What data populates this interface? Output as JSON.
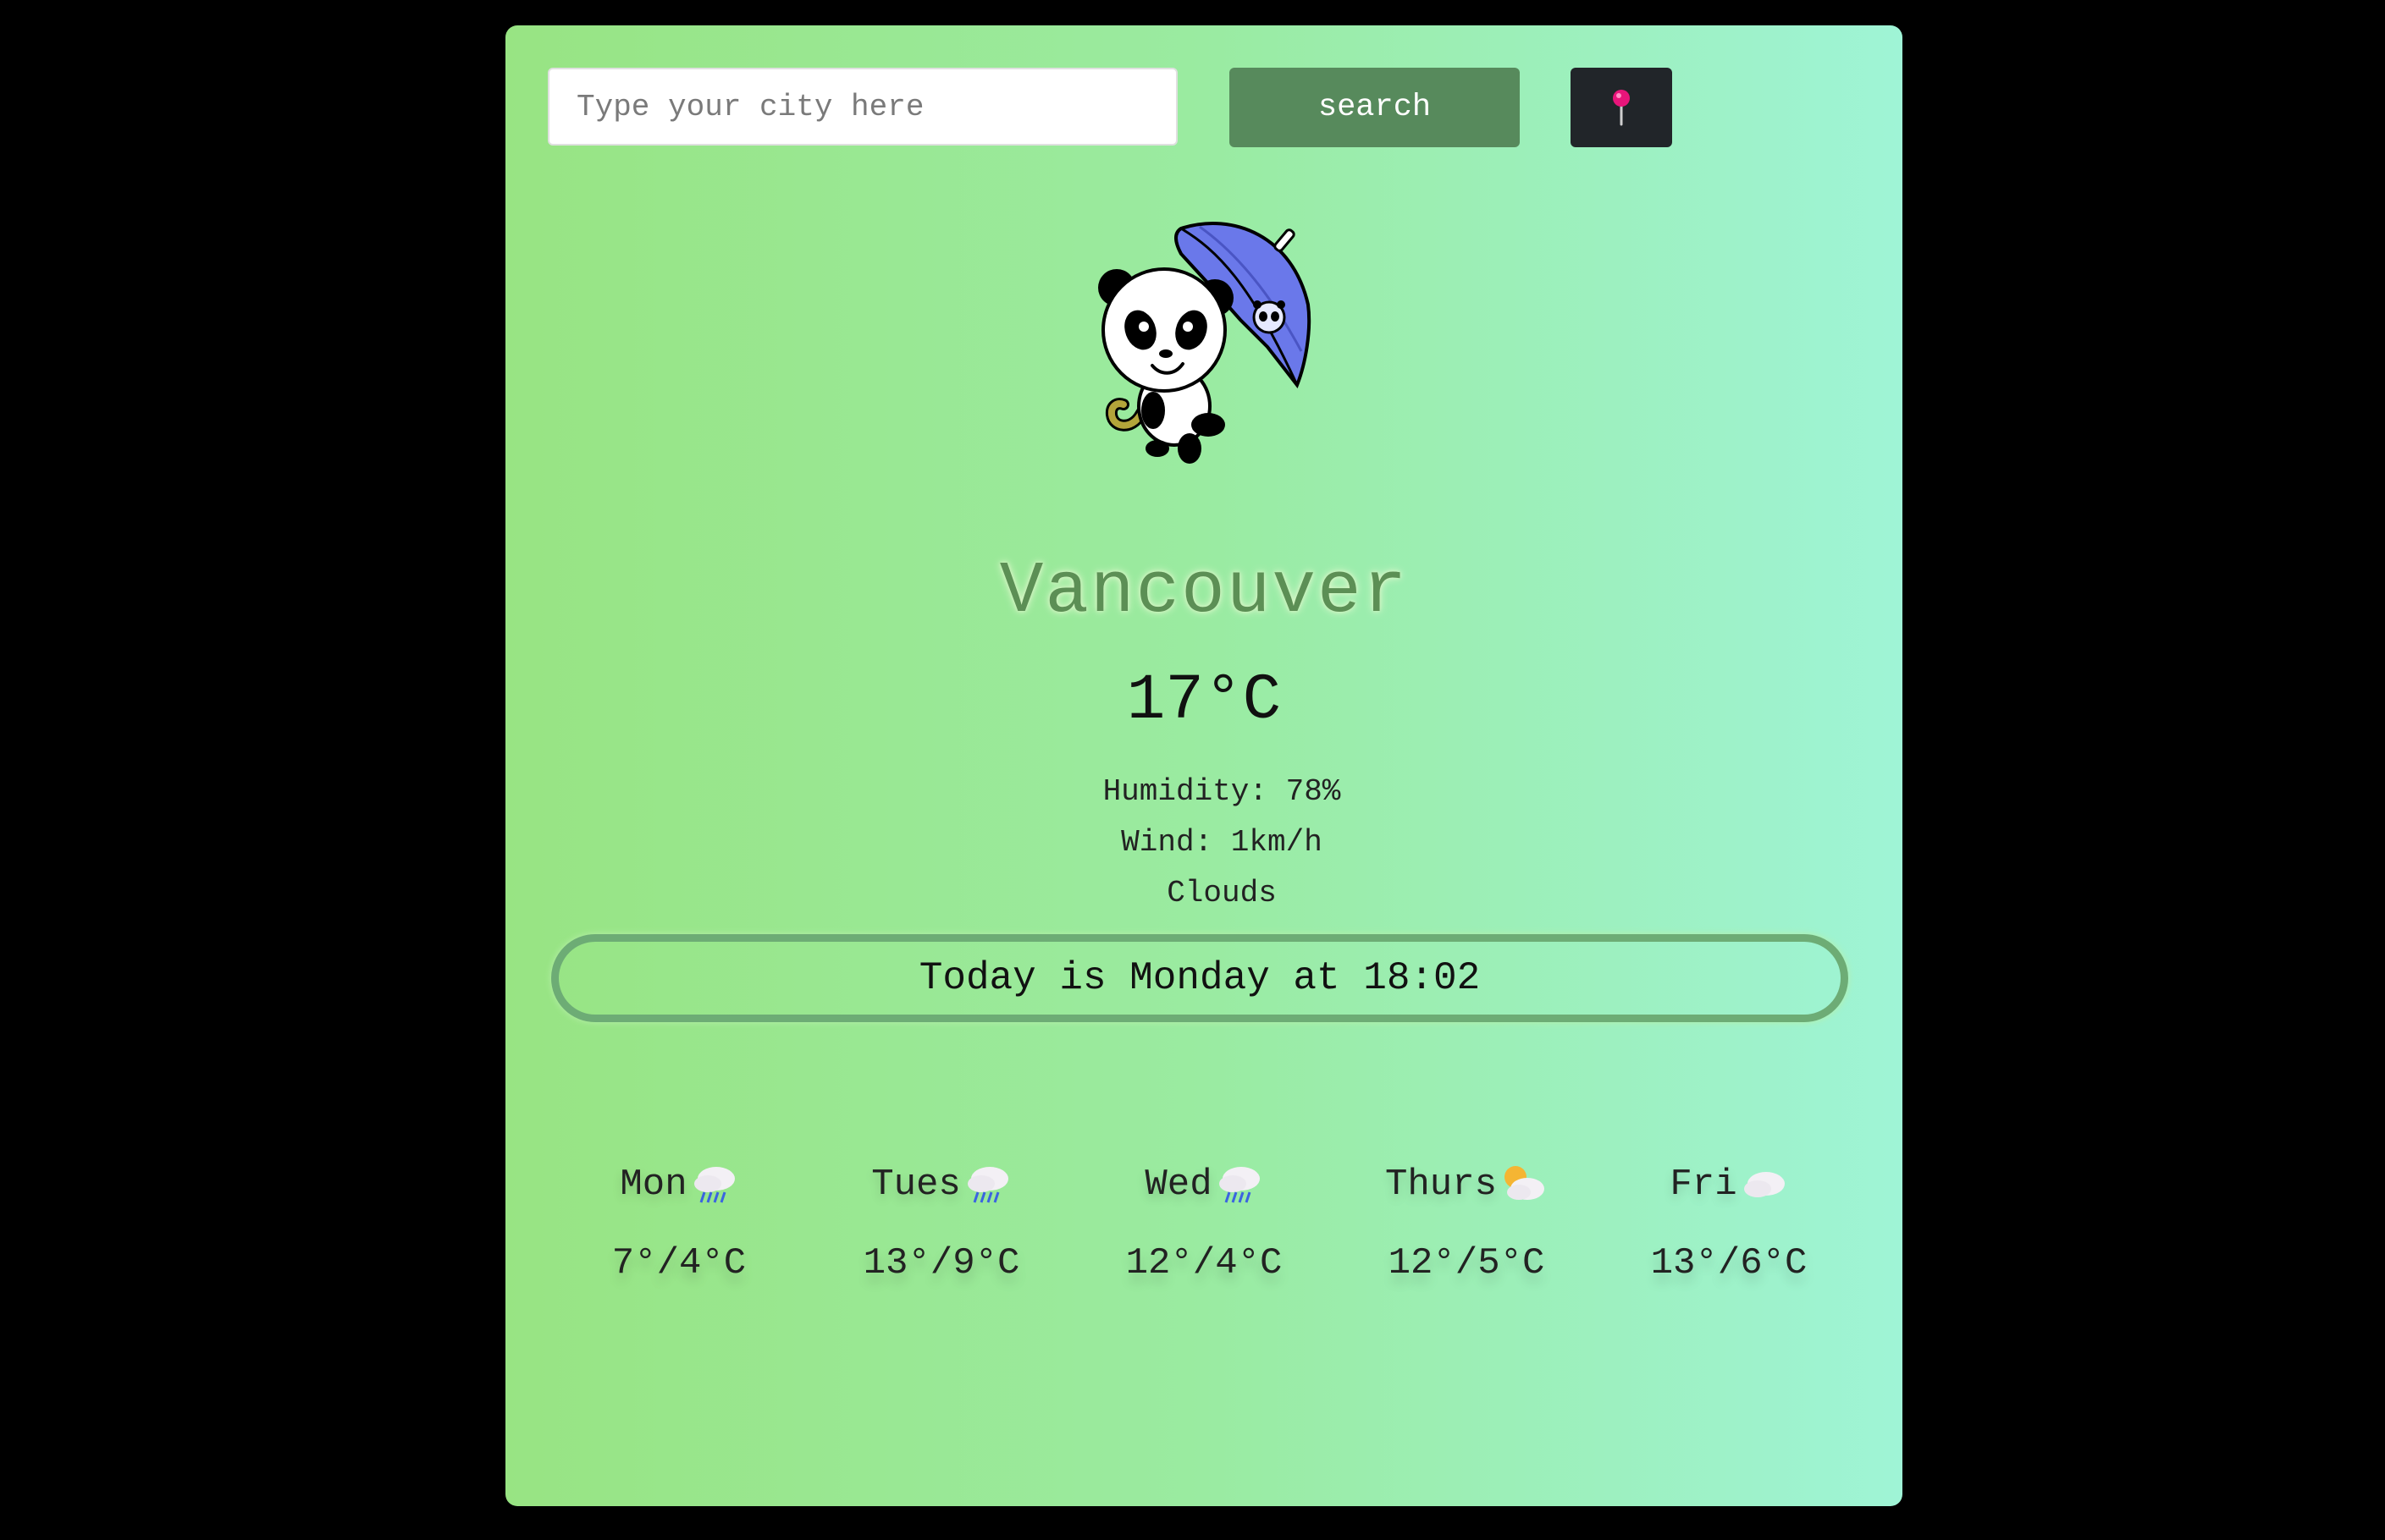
{
  "search": {
    "placeholder": "Type your city here",
    "button_label": "search",
    "location_icon": "pin-icon"
  },
  "weather": {
    "city": "Vancouver",
    "temperature": "17°C",
    "humidity": "Humidity: 78%",
    "wind": "Wind: 1km/h",
    "condition": "Clouds",
    "today": "Today is Monday at 18:02"
  },
  "forecast": [
    {
      "day": "Mon",
      "icon": "rain-cloud-icon",
      "temps": "7°/4°C"
    },
    {
      "day": "Tues",
      "icon": "rain-cloud-icon",
      "temps": "13°/9°C"
    },
    {
      "day": "Wed",
      "icon": "rain-cloud-icon",
      "temps": "12°/4°C"
    },
    {
      "day": "Thurs",
      "icon": "sun-behind-cloud-icon",
      "temps": "12°/5°C"
    },
    {
      "day": "Fri",
      "icon": "cloud-icon",
      "temps": "13°/6°C"
    }
  ],
  "colors": {
    "page_background": "#000000",
    "card_gradient_start": "#98e483",
    "card_gradient_end": "#9ff4d6",
    "search_button": "#578a5c",
    "location_button": "#212529",
    "city_text": "#5c8f55",
    "today_border": "#6dac75"
  }
}
